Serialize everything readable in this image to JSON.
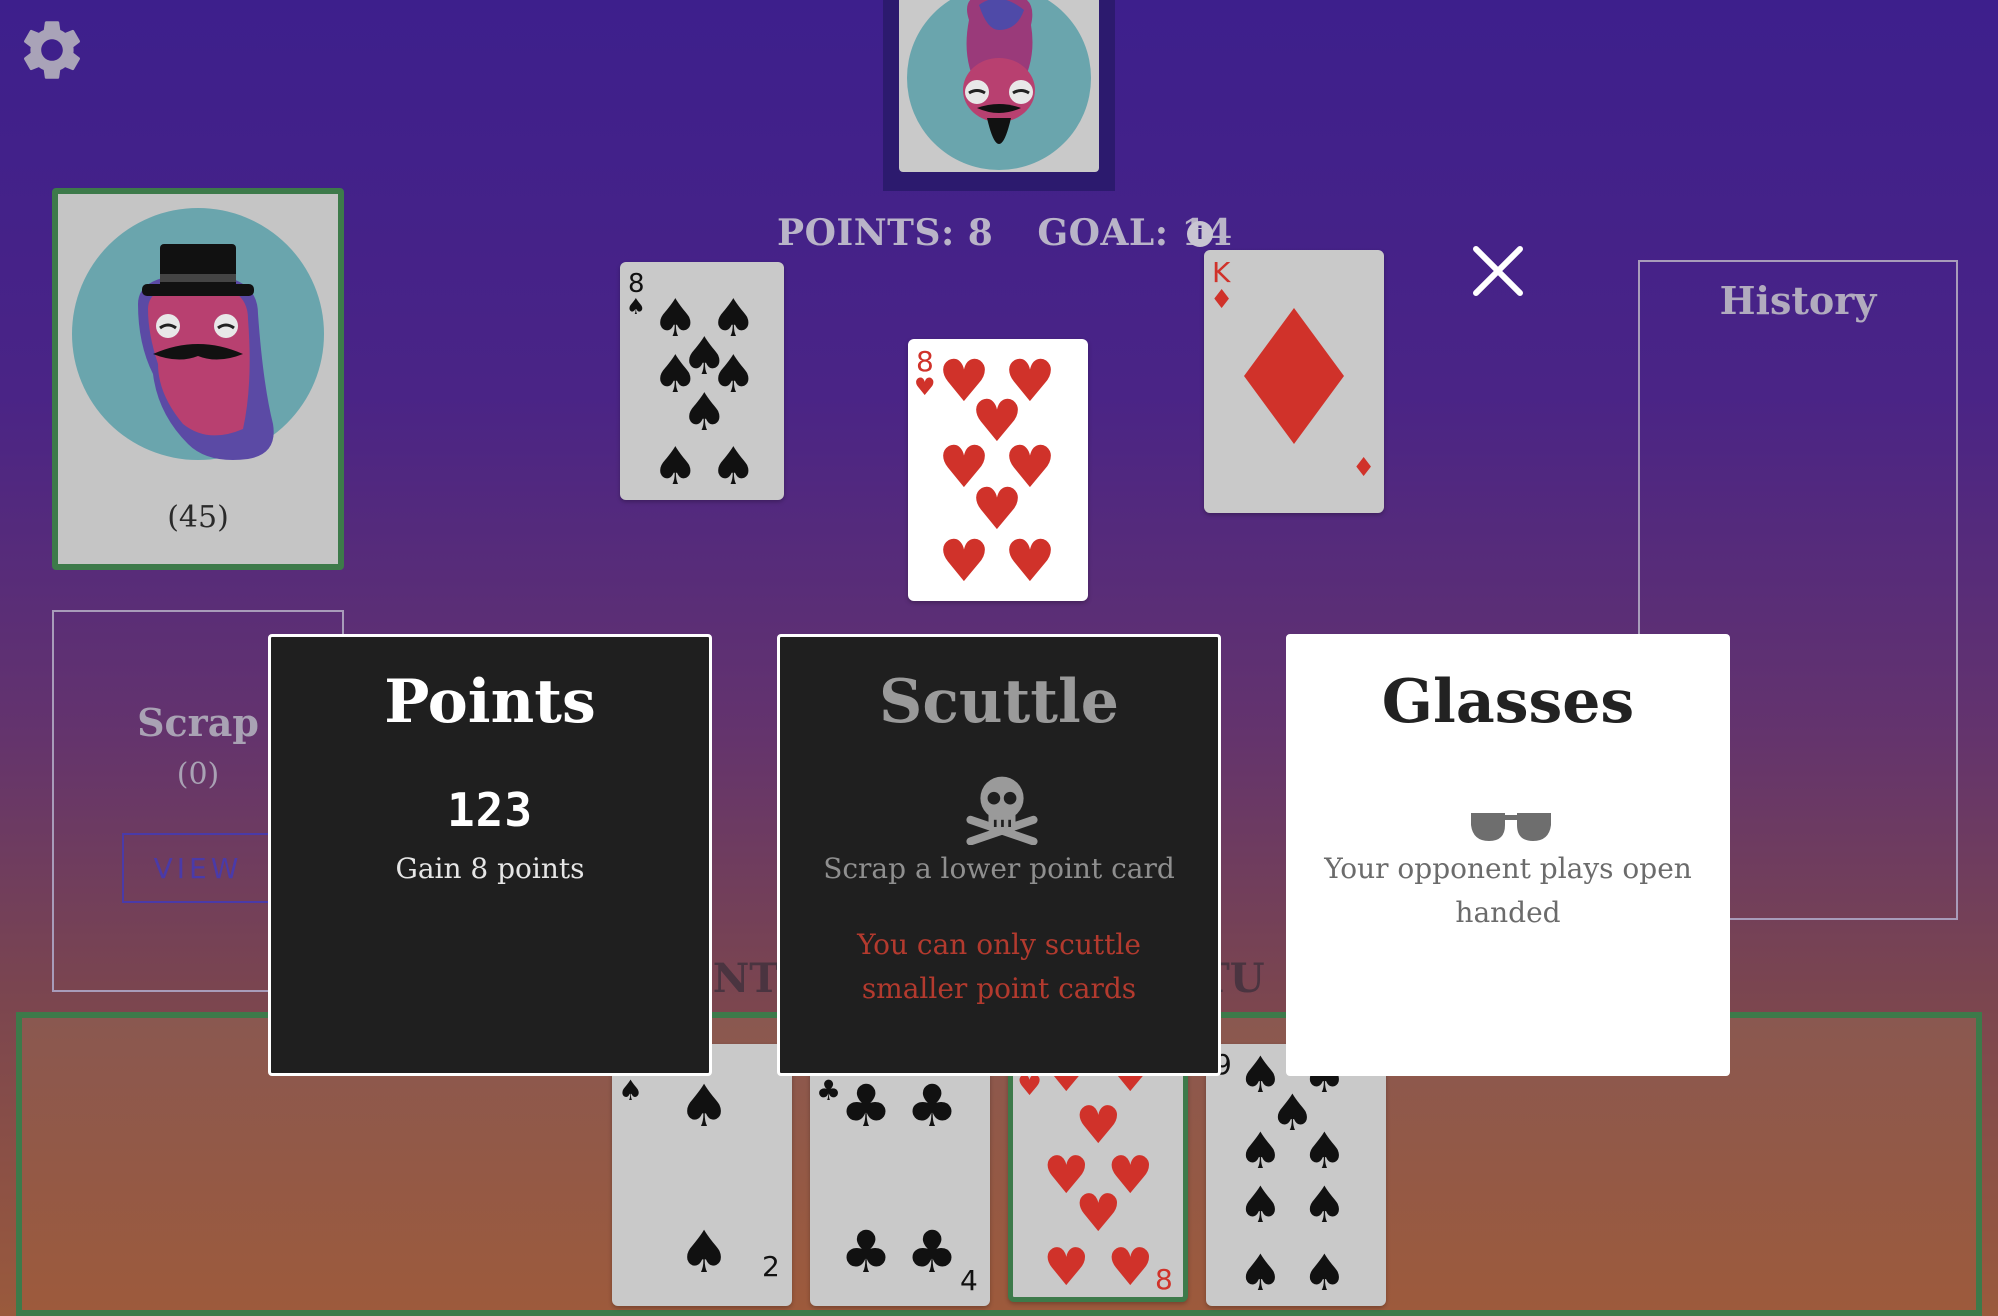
{
  "settings": {
    "icon": "gear-icon"
  },
  "opponent": {
    "avatar": "opponent-avatar"
  },
  "scoreboard": {
    "points": "POINTS: 8",
    "goal": "GOAL: 14",
    "info_icon": "i"
  },
  "deck": {
    "count": "(45)"
  },
  "scrap": {
    "title": "Scrap",
    "count": "(0)",
    "view_label": "VIEW"
  },
  "history": {
    "title": "History"
  },
  "table": {
    "opponent_points": [
      {
        "rank": "8",
        "suit": "spades"
      }
    ],
    "selected_target": {
      "rank": "8",
      "suit": "hearts"
    },
    "opponent_faces": [
      {
        "rank": "K",
        "suit": "diamonds"
      }
    ]
  },
  "peek_texts": {
    "left": "INTS",
    "right": "TU"
  },
  "hand": [
    {
      "rank": "2",
      "suit": "spades"
    },
    {
      "rank": "4",
      "suit": "clubs"
    },
    {
      "rank": "8",
      "suit": "hearts",
      "selected": true
    },
    {
      "rank": "9",
      "suit": "spades"
    }
  ],
  "options": [
    {
      "title": "Points",
      "icon_text": "123",
      "description": "Gain 8 points",
      "warning": ""
    },
    {
      "title": "Scuttle",
      "icon": "skull-crossbones-icon",
      "description": "Scrap a lower point card",
      "warning": "You can only scuttle smaller point cards"
    },
    {
      "title": "Glasses",
      "icon": "sunglasses-icon",
      "description": "Your opponent plays open handed",
      "warning": ""
    }
  ],
  "colors": {
    "accent_green": "#3d7a4a",
    "card_red": "#d0322a",
    "warning_red": "#b33a2e",
    "view_button": "#4a3aa8"
  }
}
